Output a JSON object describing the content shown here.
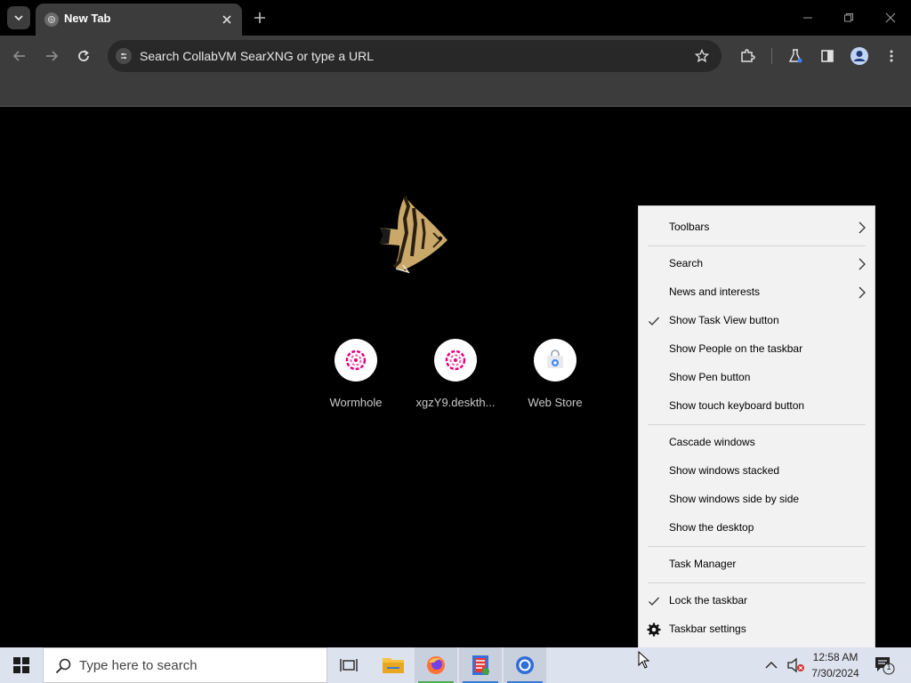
{
  "browser": {
    "tab": {
      "title": "New Tab"
    },
    "omnibox": {
      "placeholder": "Search CollabVM SearXNG or type a URL"
    },
    "icons": {
      "tab_search": "chevron-down-icon",
      "favicon": "chrome-globe-icon",
      "close": "close-icon",
      "new_tab": "plus-icon",
      "minimize": "minimize-icon",
      "restore": "restore-icon",
      "window_close": "close-icon",
      "back": "back-arrow-icon",
      "forward": "forward-arrow-icon",
      "reload": "reload-icon",
      "star": "star-icon",
      "extensions": "puzzle-icon",
      "labs": "flask-icon",
      "side_panel": "side-panel-icon",
      "profile": "profile-icon",
      "menu": "kebab-menu-icon"
    }
  },
  "ntp": {
    "shortcuts": [
      {
        "label": "Wormhole",
        "icon": "wormhole-icon"
      },
      {
        "label": "xgzY9.deskth...",
        "icon": "wormhole-icon"
      },
      {
        "label": "Web Store",
        "icon": "web-store-icon"
      }
    ]
  },
  "context_menu": {
    "items": [
      {
        "label": "Toolbars",
        "submenu": true
      },
      {
        "label": "Search",
        "submenu": true
      },
      {
        "label": "News and interests",
        "submenu": true
      },
      {
        "label": "Show Task View button",
        "checked": true
      },
      {
        "label": "Show People on the taskbar"
      },
      {
        "label": "Show Pen button"
      },
      {
        "label": "Show touch keyboard button"
      },
      {
        "label": "Cascade windows"
      },
      {
        "label": "Show windows stacked"
      },
      {
        "label": "Show windows side by side"
      },
      {
        "label": "Show the desktop"
      },
      {
        "label": "Task Manager"
      },
      {
        "label": "Lock the taskbar",
        "checked": true
      },
      {
        "label": "Taskbar settings",
        "icon": "gear-icon"
      }
    ]
  },
  "taskbar": {
    "search_placeholder": "Type here to search",
    "apps": [
      "task-view-icon",
      "file-explorer-icon",
      "firefox-icon",
      "app-icon",
      "chrome-icon"
    ],
    "tray": {
      "time": "12:58 AM",
      "date": "7/30/2024",
      "notification_count": "1"
    }
  },
  "colors": {
    "chrome_bg": "#3c3c3c",
    "omnibox_bg": "#282828",
    "menu_bg": "#f2f2f2",
    "taskbar_bg": "#dde3ee",
    "shortcut_accent": "#e6007e"
  }
}
